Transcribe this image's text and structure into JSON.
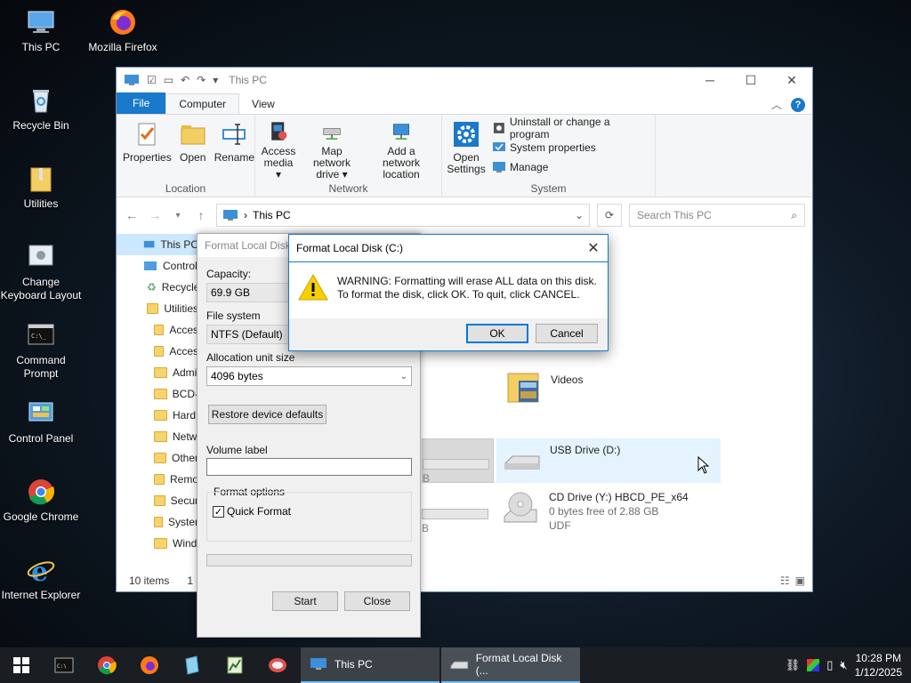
{
  "desktop": {
    "icons": [
      {
        "label": "This PC"
      },
      {
        "label": "Mozilla Firefox"
      },
      {
        "label": "Recycle Bin"
      },
      {
        "label": "Utilities"
      },
      {
        "label": "Change Keyboard Layout"
      },
      {
        "label": "Command Prompt"
      },
      {
        "label": "Control Panel"
      },
      {
        "label": "Google Chrome"
      },
      {
        "label": "Internet Explorer"
      }
    ]
  },
  "explorer": {
    "title": "This PC",
    "tabs": {
      "file": "File",
      "computer": "Computer",
      "view": "View"
    },
    "ribbon": {
      "location_group": "Location",
      "properties": "Properties",
      "open": "Open",
      "rename": "Rename",
      "network_group": "Network",
      "access_media": "Access media ▾",
      "map_drive": "Map network drive ▾",
      "add_location": "Add a network location",
      "system_group": "System",
      "open_settings": "Open Settings",
      "uninstall": "Uninstall or change a program",
      "system_properties": "System properties",
      "manage": "Manage"
    },
    "address": "This PC",
    "search_placeholder": "Search This PC",
    "nav_items": [
      {
        "label": "This PC"
      },
      {
        "label": "Control"
      },
      {
        "label": "Recycle"
      },
      {
        "label": "Utilities"
      },
      {
        "label": "Acces"
      },
      {
        "label": "Acces"
      },
      {
        "label": "Admi"
      },
      {
        "label": "BCD-"
      },
      {
        "label": "Hard"
      },
      {
        "label": "Netw"
      },
      {
        "label": "Other"
      },
      {
        "label": "Remo"
      },
      {
        "label": "Secur"
      },
      {
        "label": "Syster"
      },
      {
        "label": "Wind"
      }
    ],
    "content": {
      "videos": "Videos",
      "partial_1": "B",
      "partial_2": "B",
      "usb_name": "USB Drive (D:)",
      "cd_name": "CD Drive (Y:) HBCD_PE_x64",
      "cd_free": "0 bytes free of 2.88 GB",
      "cd_fs": "UDF"
    },
    "status": {
      "items": "10 items",
      "selected": "1 i"
    }
  },
  "format_panel": {
    "title": "Format Local Disk",
    "capacity_label": "Capacity:",
    "capacity_value": "69.9 GB",
    "filesystem_label": "File system",
    "filesystem_value": "NTFS (Default)",
    "alloc_label": "Allocation unit size",
    "alloc_value": "4096 bytes",
    "restore_btn": "Restore device defaults",
    "volume_label": "Volume label",
    "volume_value": "",
    "options_label": "Format options",
    "quick_format": "Quick Format",
    "quick_format_checked": true,
    "start_btn": "Start",
    "close_btn": "Close"
  },
  "dialog": {
    "title": "Format Local Disk (C:)",
    "line1": "WARNING: Formatting will erase ALL data on this disk.",
    "line2": "To format the disk, click OK. To quit, click CANCEL.",
    "ok": "OK",
    "cancel": "Cancel"
  },
  "taskbar": {
    "tasks": [
      {
        "label": "This PC"
      },
      {
        "label": "Format Local Disk (..."
      }
    ],
    "time": "10:28 PM",
    "date": "1/12/2025"
  }
}
